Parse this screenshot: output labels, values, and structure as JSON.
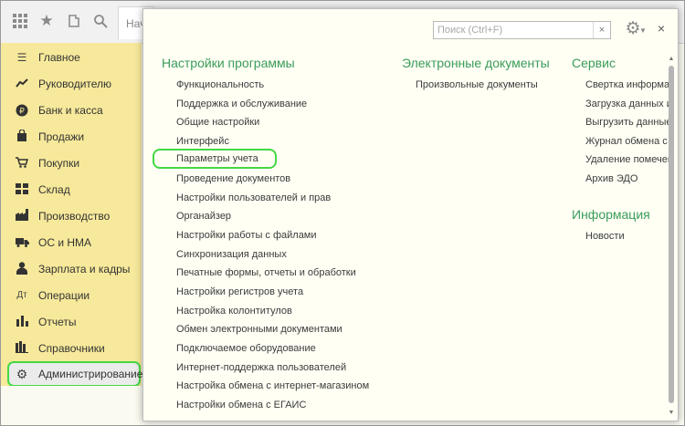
{
  "topbar": {
    "start_tab_label": "Начальная",
    "icons": [
      "apps-grid-icon",
      "star-icon",
      "history-icon",
      "search-icon"
    ]
  },
  "sidebar": {
    "items": [
      {
        "label": "Главное",
        "icon": "menu-lines-icon"
      },
      {
        "label": "Руководителю",
        "icon": "trend-icon"
      },
      {
        "label": "Банк и касса",
        "icon": "ruble-coin-icon"
      },
      {
        "label": "Продажи",
        "icon": "shopping-bag-icon"
      },
      {
        "label": "Покупки",
        "icon": "cart-icon"
      },
      {
        "label": "Склад",
        "icon": "warehouse-icon"
      },
      {
        "label": "Производство",
        "icon": "factory-icon"
      },
      {
        "label": "ОС и НМА",
        "icon": "truck-icon"
      },
      {
        "label": "Зарплата и кадры",
        "icon": "person-icon"
      },
      {
        "label": "Операции",
        "icon": "operations-icon"
      },
      {
        "label": "Отчеты",
        "icon": "bar-chart-icon"
      },
      {
        "label": "Справочники",
        "icon": "books-icon"
      },
      {
        "label": "Администрирование",
        "icon": "gear-icon",
        "active": true
      }
    ]
  },
  "panel": {
    "search_placeholder": "Поиск (Ctrl+F)",
    "search_clear": "×",
    "close": "×",
    "sections": {
      "settings": {
        "title": "Настройки программы",
        "items": [
          "Функциональность",
          "Поддержка и обслуживание",
          "Общие настройки",
          "Интерфейс",
          "Параметры учета",
          "Проведение документов",
          "Настройки пользователей и прав",
          "Органайзер",
          "Настройки работы с файлами",
          "Синхронизация данных",
          "Печатные формы, отчеты и обработки",
          "Настройки регистров учета",
          "Настройка колонтитулов",
          "Обмен электронными документами",
          "Подключаемое оборудование",
          "Интернет-поддержка пользователей",
          "Настройка обмена с интернет-магазином",
          "Настройки обмена с ЕГАИС"
        ]
      },
      "edocs": {
        "title": "Электронные документы",
        "items": [
          "Произвольные документы"
        ]
      },
      "service": {
        "title": "Сервис",
        "items": [
          "Свертка информа",
          "Загрузка данных и",
          "Выгрузить данные",
          "Журнал обмена с",
          "Удаление помечен",
          "Архив ЭДО"
        ]
      },
      "info": {
        "title": "Информация",
        "items": [
          "Новости"
        ]
      }
    }
  },
  "colors": {
    "sidebar_bg": "#f7e99b",
    "section_title": "#3a9c5a",
    "highlight_outline": "#44d844"
  }
}
